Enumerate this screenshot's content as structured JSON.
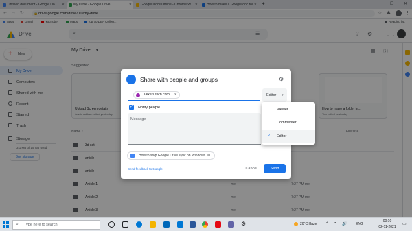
{
  "browser": {
    "tabs": [
      {
        "title": "Untitled document - Google Do",
        "active": false
      },
      {
        "title": "My Drive - Google Drive",
        "active": true
      },
      {
        "title": "Google Docs Offline - Chrome W",
        "active": false
      },
      {
        "title": "How to make a Google doc fol",
        "active": false
      }
    ],
    "new_tab": "+",
    "url": "drive.google.com/drive/u/0/my-drive",
    "bookmarks": [
      "Apps",
      "Gmail",
      "YouTube",
      "Maps",
      "Top 70 DBA Colleg..."
    ],
    "reading_list": "Reading list"
  },
  "drive": {
    "logo_text": "Drive",
    "new_label": "New",
    "title": "My Drive",
    "suggested_label": "Suggested",
    "sidebar": [
      {
        "label": "My Drive"
      },
      {
        "label": "Computers"
      },
      {
        "label": "Shared with me"
      },
      {
        "label": "Recent"
      },
      {
        "label": "Starred"
      },
      {
        "label": "Trash"
      }
    ],
    "storage_label": "Storage",
    "storage_text": "3.1 MB of 15 GB used",
    "buy_storage": "Buy storage",
    "cards": [
      {
        "title": "Upload Screen details",
        "sub": "Jessie Adikan edited yesterday"
      },
      {
        "title": "How to make a folder in...",
        "sub": "You edited yesterday"
      }
    ],
    "list_header": {
      "name": "Name",
      "size": "File size"
    },
    "rows": [
      {
        "name": "3d set",
        "owner": "",
        "modified": "",
        "size": "—"
      },
      {
        "name": "article",
        "owner": "",
        "modified": "",
        "size": "—"
      },
      {
        "name": "article",
        "owner": "",
        "modified": "",
        "size": "—"
      },
      {
        "name": "Article 1",
        "owner": "me",
        "modified": "7:27 PM  me",
        "size": "—"
      },
      {
        "name": "Article 2",
        "owner": "me",
        "modified": "7:27 PM  me",
        "size": "—"
      },
      {
        "name": "Article 3",
        "owner": "me",
        "modified": "7:27 PM  me",
        "size": "—"
      }
    ]
  },
  "dialog": {
    "title": "Share with people and groups",
    "chip_label": "Talkers tech corp",
    "role_button": "Editor",
    "notify_label": "Notify people",
    "message_placeholder": "Message",
    "suggestion": "How to stop Google Drive sync on Windows 10",
    "feedback_link": "Send feedback to Google",
    "cancel": "Cancel",
    "send": "Send"
  },
  "role_menu": {
    "items": [
      "Viewer",
      "Commenter",
      "Editor"
    ],
    "selected": "Editor"
  },
  "taskbar": {
    "search_placeholder": "Type here to search",
    "weather": "20°C  Haze",
    "language": "ENG",
    "time": "00:10",
    "date": "02-11-2021"
  },
  "colors": {
    "accent": "#1a73e8",
    "new_button_plus": "#ea4335"
  }
}
